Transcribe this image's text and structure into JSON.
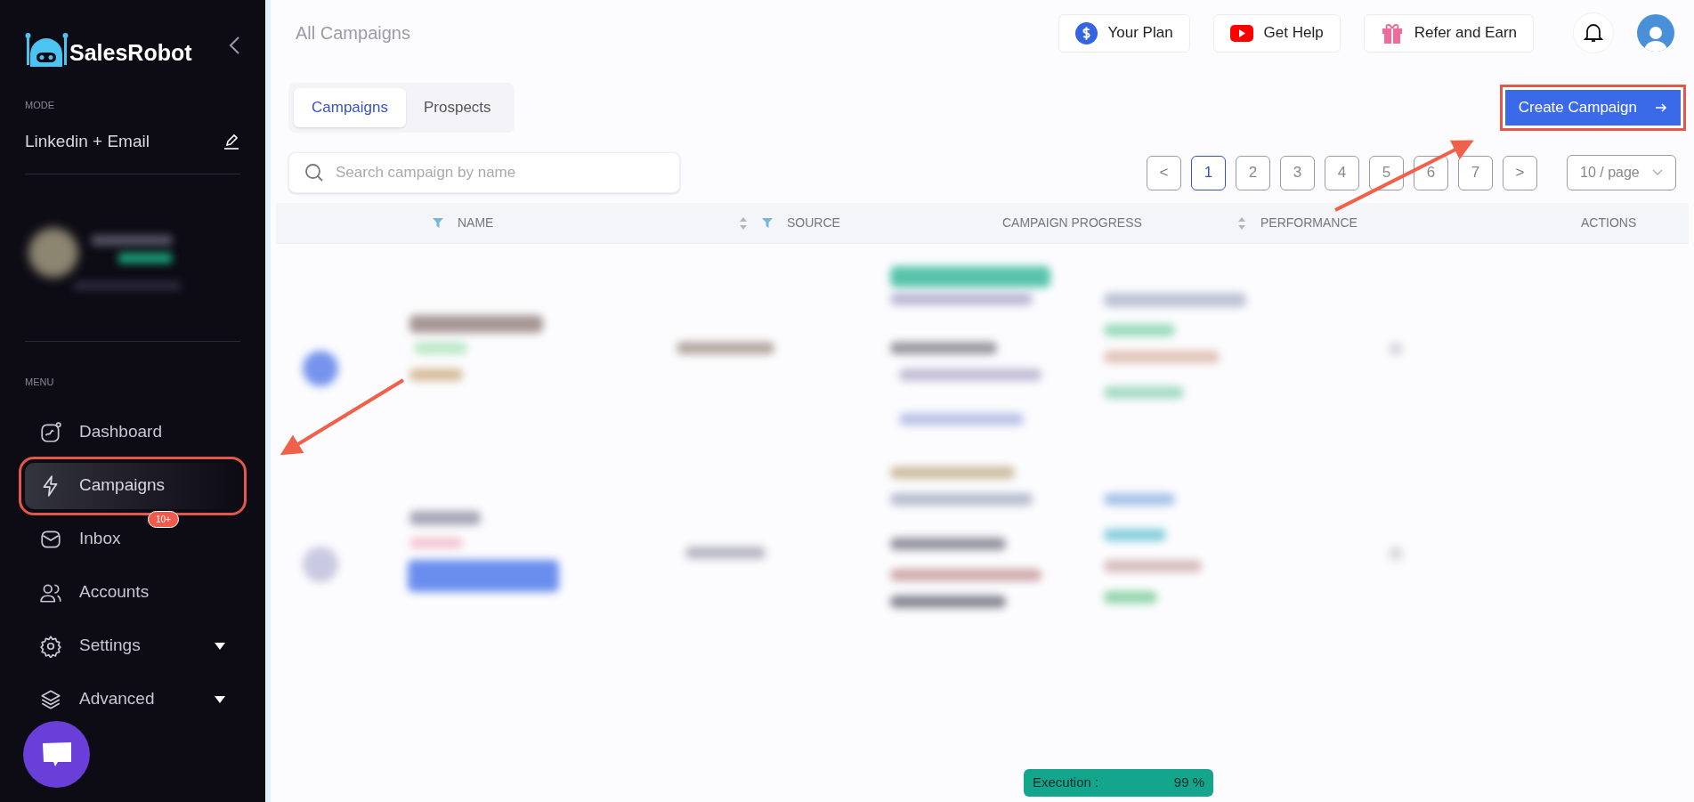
{
  "sidebar": {
    "brand": "SalesRobot",
    "mode_label": "MODE",
    "mode_value": "Linkedin + Email",
    "menu_label": "MENU",
    "items": [
      {
        "kind": "dashboard",
        "label": "Dashboard",
        "selected": false,
        "highlighted": false,
        "expandable": false
      },
      {
        "kind": "campaigns",
        "label": "Campaigns",
        "selected": true,
        "highlighted": true,
        "expandable": false
      },
      {
        "kind": "inbox",
        "label": "Inbox",
        "selected": false,
        "highlighted": false,
        "expandable": false,
        "badge": "10+"
      },
      {
        "kind": "accounts",
        "label": "Accounts",
        "selected": false,
        "highlighted": false,
        "expandable": false
      },
      {
        "kind": "settings",
        "label": "Settings",
        "selected": false,
        "highlighted": false,
        "expandable": true
      },
      {
        "kind": "advanced",
        "label": "Advanced",
        "selected": false,
        "highlighted": false,
        "expandable": true
      }
    ]
  },
  "header": {
    "title": "All Campaigns",
    "buttons": [
      {
        "kind": "plan",
        "label": "Your Plan"
      },
      {
        "kind": "help",
        "label": "Get Help"
      },
      {
        "kind": "refer",
        "label": "Refer and Earn"
      }
    ]
  },
  "tabs": [
    {
      "label": "Campaigns",
      "selected": true
    },
    {
      "label": "Prospects",
      "selected": false
    }
  ],
  "create_button": {
    "label": "Create Campaign",
    "highlighted": true
  },
  "search": {
    "placeholder": "Search campaign by name"
  },
  "pagination": {
    "prev": "<",
    "next": ">",
    "page_size": "10 / page",
    "pages": [
      {
        "label": "1",
        "selected": true
      },
      {
        "label": "2",
        "selected": false
      },
      {
        "label": "3",
        "selected": false
      },
      {
        "label": "4",
        "selected": false
      },
      {
        "label": "5",
        "selected": false
      },
      {
        "label": "6",
        "selected": false
      },
      {
        "label": "7",
        "selected": false
      }
    ]
  },
  "table": {
    "columns": [
      {
        "label": "NAME",
        "filter": true,
        "sort": true
      },
      {
        "label": "SOURCE",
        "filter": true,
        "sort": false
      },
      {
        "label": "CAMPAIGN PROGRESS",
        "filter": false,
        "sort": true
      },
      {
        "label": "PERFORMANCE",
        "filter": false,
        "sort": false
      },
      {
        "label": "ACTIONS",
        "filter": false,
        "sort": false
      }
    ]
  },
  "execution": {
    "label": "Execution :",
    "value": "99 %"
  }
}
